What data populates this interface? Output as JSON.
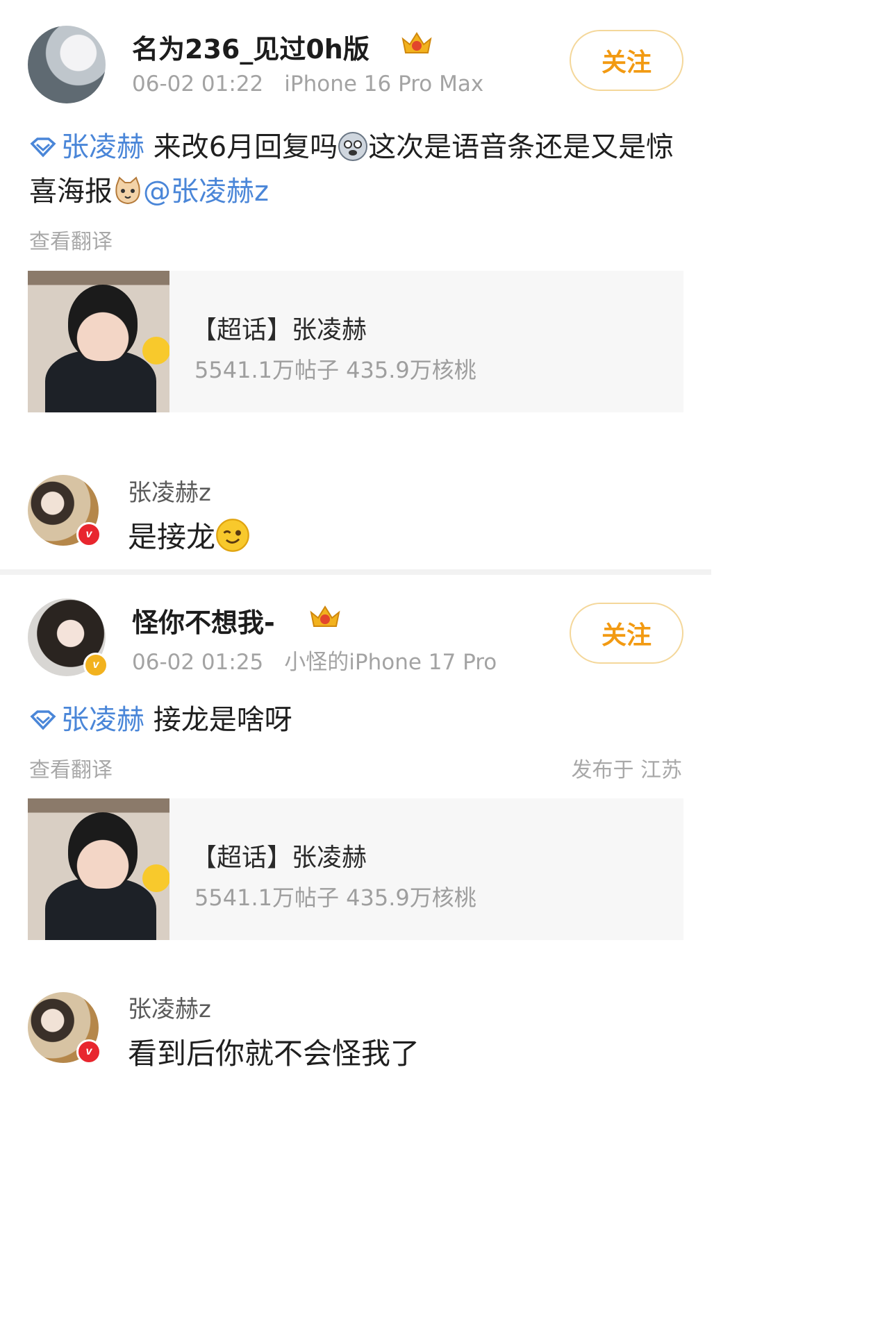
{
  "posts": [
    {
      "username": "名为236_见过0h版",
      "time": "06-02 01:22",
      "device": "iPhone 16 Pro Max",
      "follow_label": "关注",
      "topic": "张凌赫",
      "text_a": "来改6月回复吗",
      "text_b": "这次是语音条还是又是惊喜海报",
      "mention": "@张凌赫z",
      "translate_label": "查看翻译",
      "card": {
        "title": "【超话】张凌赫",
        "stats": "5541.1万帖子 435.9万核桃"
      },
      "reply": {
        "name": "张凌赫z",
        "text": "是接龙"
      },
      "emoji_icons": [
        "husky-emoji-icon",
        "cat-emoji-icon",
        "wink-emoji-icon"
      ],
      "badge_icon": "crown-level-icon"
    },
    {
      "username": "怪你不想我-",
      "time": "06-02 01:25",
      "device": "小怪的iPhone 17 Pro",
      "follow_label": "关注",
      "topic": "张凌赫",
      "text": "接龙是啥呀",
      "translate_label": "查看翻译",
      "location": "发布于 江苏",
      "card": {
        "title": "【超话】张凌赫",
        "stats": "5541.1万帖子 435.9万核桃"
      },
      "reply": {
        "name": "张凌赫z",
        "text": "看到后你就不会怪我了"
      },
      "badge_icon": "crown-level-icon"
    }
  ],
  "colors": {
    "link": "#4a86d8",
    "follow_text": "#f29a12",
    "follow_border": "#f4d79a",
    "meta": "#a3a3a3",
    "verified_red": "#e8262e",
    "verified_gold": "#f2b21e"
  }
}
